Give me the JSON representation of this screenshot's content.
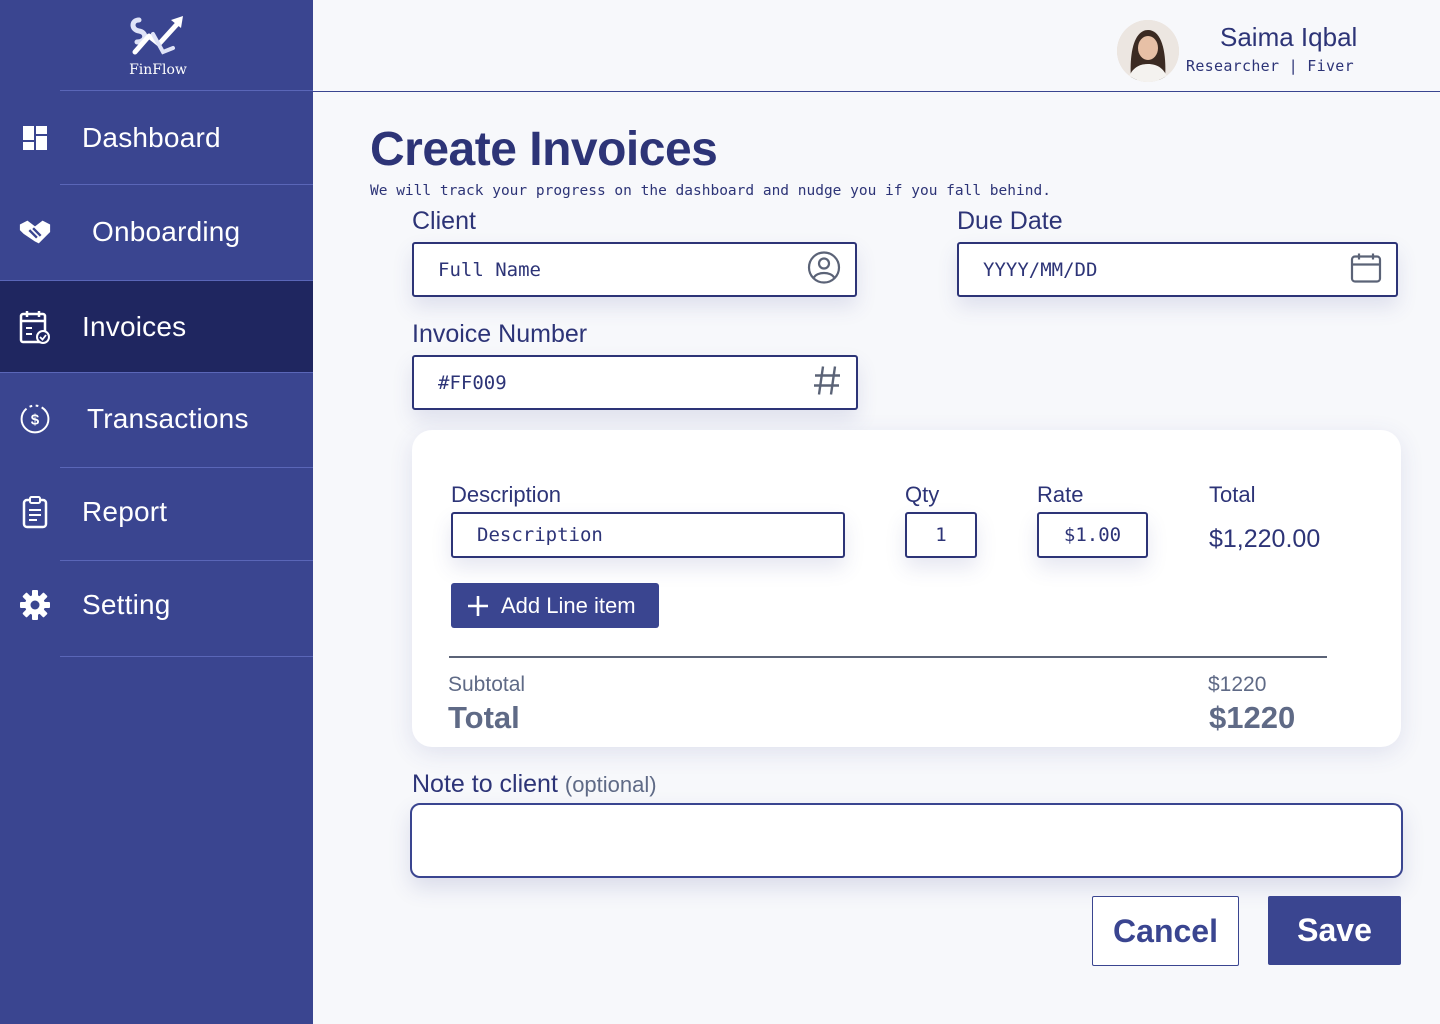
{
  "brand": {
    "name": "FinFlow"
  },
  "sidebar": {
    "items": [
      {
        "label": "Dashboard",
        "icon": "dashboard-icon",
        "active": false
      },
      {
        "label": "Onboarding",
        "icon": "handshake-icon",
        "active": false
      },
      {
        "label": "Invoices",
        "icon": "invoice-calendar-icon",
        "active": true
      },
      {
        "label": "Transactions",
        "icon": "dollar-circle-icon",
        "active": false
      },
      {
        "label": "Report",
        "icon": "clipboard-icon",
        "active": false
      },
      {
        "label": "Setting",
        "icon": "gear-icon",
        "active": false
      }
    ]
  },
  "user": {
    "name": "Saima Iqbal",
    "role": "Researcher | Fiver"
  },
  "page": {
    "title": "Create Invoices",
    "subtitle": "We will track your progress on the dashboard and nudge you if you fall behind."
  },
  "form": {
    "client_label": "Client",
    "client_placeholder": "Full Name",
    "due_date_label": "Due Date",
    "due_date_placeholder": "YYYY/MM/DD",
    "invoice_number_label": "Invoice Number",
    "invoice_number_value": "#FF009"
  },
  "line_items": {
    "headers": {
      "description": "Description",
      "qty": "Qty",
      "rate": "Rate",
      "total": "Total"
    },
    "row": {
      "description_placeholder": "Description",
      "qty": "1",
      "rate": "$1.00",
      "total": "$1,220.00"
    },
    "add_label": "Add Line item"
  },
  "summary": {
    "subtotal_label": "Subtotal",
    "subtotal_value": "$1220",
    "total_label": "Total",
    "total_value": "$1220"
  },
  "note": {
    "label": "Note to client",
    "optional": "(optional)",
    "value": ""
  },
  "actions": {
    "cancel": "Cancel",
    "save": "Save"
  },
  "colors": {
    "sidebar": "#3a4590",
    "active": "#1f2660",
    "text": "#2d3477",
    "muted": "#5f6a86"
  }
}
